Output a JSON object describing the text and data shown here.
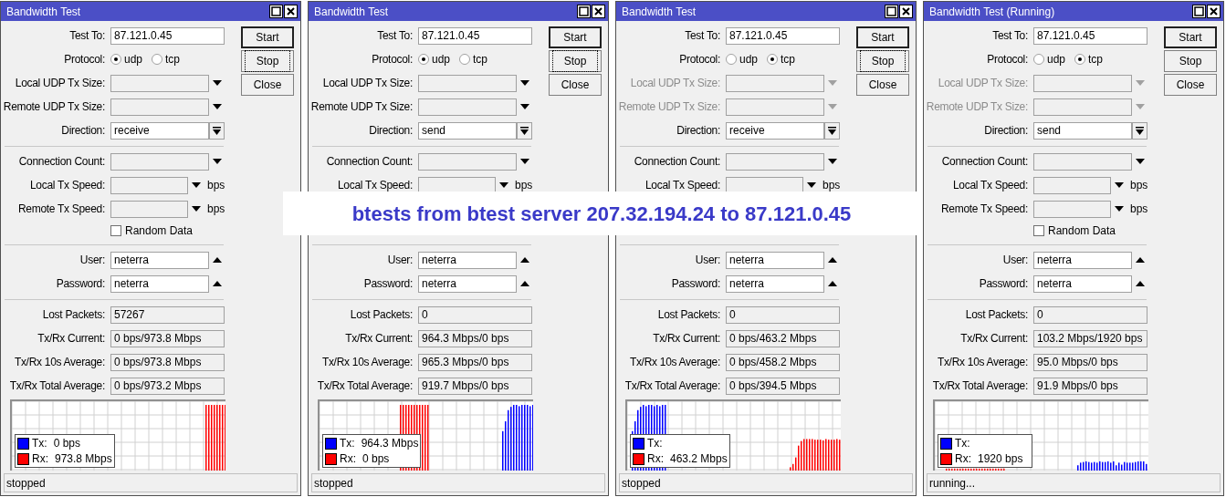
{
  "windows": [
    {
      "title": "Bandwidth Test",
      "buttons": [
        {
          "label": "Start",
          "default": true,
          "focused": false
        },
        {
          "label": "Stop",
          "default": false,
          "focused": true
        },
        {
          "label": "Close",
          "default": false,
          "focused": false
        }
      ],
      "sections": [
        [
          {
            "kind": "text",
            "label": "Test To:",
            "value": "87.121.0.45"
          },
          {
            "kind": "radio",
            "label": "Protocol:",
            "options": [
              {
                "label": "udp",
                "selected": true
              },
              {
                "label": "tcp",
                "selected": false
              }
            ]
          },
          {
            "kind": "combo",
            "label": "Local UDP Tx Size:",
            "disabled": false
          },
          {
            "kind": "combo",
            "label": "Remote UDP Tx Size:",
            "disabled": false
          },
          {
            "kind": "select",
            "label": "Direction:",
            "value": "receive"
          }
        ],
        [
          {
            "kind": "combo",
            "label": "Connection Count:",
            "disabled": false
          },
          {
            "kind": "combo",
            "label": "Local Tx Speed:",
            "disabled": false,
            "unit": "bps"
          },
          {
            "kind": "combo",
            "label": "Remote Tx Speed:",
            "disabled": false,
            "unit": "bps"
          },
          {
            "kind": "checkbox",
            "label": "Random Data",
            "checked": false
          }
        ],
        [
          {
            "kind": "history",
            "label": "User:",
            "value": "neterra"
          },
          {
            "kind": "history",
            "label": "Password:",
            "value": "neterra"
          }
        ],
        [
          {
            "kind": "readonly",
            "label": "Lost Packets:",
            "value": "57267"
          },
          {
            "kind": "readonly",
            "label": "Tx/Rx Current:",
            "value": "0 bps/973.8 Mbps"
          },
          {
            "kind": "readonly",
            "label": "Tx/Rx 10s Average:",
            "value": "0 bps/973.8 Mbps"
          },
          {
            "kind": "readonly",
            "label": "Tx/Rx Total Average:",
            "value": "0 bps/973.2 Mbps"
          }
        ]
      ],
      "legend": [
        {
          "label": "Tx:",
          "value": "0 bps",
          "color": "#0000ff"
        },
        {
          "label": "Rx:",
          "value": "973.8 Mbps",
          "color": "#ff0000"
        }
      ],
      "status": "stopped"
    },
    {
      "title": "Bandwidth Test",
      "buttons": [
        {
          "label": "Start",
          "default": true,
          "focused": false
        },
        {
          "label": "Stop",
          "default": false,
          "focused": true
        },
        {
          "label": "Close",
          "default": false,
          "focused": false
        }
      ],
      "sections": [
        [
          {
            "kind": "text",
            "label": "Test To:",
            "value": "87.121.0.45"
          },
          {
            "kind": "radio",
            "label": "Protocol:",
            "options": [
              {
                "label": "udp",
                "selected": true
              },
              {
                "label": "tcp",
                "selected": false
              }
            ]
          },
          {
            "kind": "combo",
            "label": "Local UDP Tx Size:",
            "disabled": false
          },
          {
            "kind": "combo",
            "label": "Remote UDP Tx Size:",
            "disabled": false
          },
          {
            "kind": "select",
            "label": "Direction:",
            "value": "send"
          }
        ],
        [
          {
            "kind": "combo",
            "label": "Connection Count:",
            "disabled": false
          },
          {
            "kind": "combo",
            "label": "Local Tx Speed:",
            "disabled": false,
            "unit": "bps"
          }
        ],
        [
          {
            "kind": "history",
            "label": "User:",
            "value": "neterra"
          },
          {
            "kind": "history",
            "label": "Password:",
            "value": "neterra"
          }
        ],
        [
          {
            "kind": "readonly",
            "label": "Lost Packets:",
            "value": "0"
          },
          {
            "kind": "readonly",
            "label": "Tx/Rx Current:",
            "value": "964.3 Mbps/0 bps"
          },
          {
            "kind": "readonly",
            "label": "Tx/Rx 10s Average:",
            "value": "965.3 Mbps/0 bps"
          },
          {
            "kind": "readonly",
            "label": "Tx/Rx Total Average:",
            "value": "919.7 Mbps/0 bps"
          }
        ]
      ],
      "legend": [
        {
          "label": "Tx:",
          "value": "964.3 Mbps",
          "color": "#0000ff"
        },
        {
          "label": "Rx:",
          "value": "0 bps",
          "color": "#ff0000"
        }
      ],
      "status": "stopped"
    },
    {
      "title": "Bandwidth Test",
      "buttons": [
        {
          "label": "Start",
          "default": true,
          "focused": false
        },
        {
          "label": "Stop",
          "default": false,
          "focused": true
        },
        {
          "label": "Close",
          "default": false,
          "focused": false
        }
      ],
      "sections": [
        [
          {
            "kind": "text",
            "label": "Test To:",
            "value": "87.121.0.45"
          },
          {
            "kind": "radio",
            "label": "Protocol:",
            "options": [
              {
                "label": "udp",
                "selected": false
              },
              {
                "label": "tcp",
                "selected": true
              }
            ]
          },
          {
            "kind": "combo",
            "label": "Local UDP Tx Size:",
            "disabled": true
          },
          {
            "kind": "combo",
            "label": "Remote UDP Tx Size:",
            "disabled": true
          },
          {
            "kind": "select",
            "label": "Direction:",
            "value": "receive"
          }
        ],
        [
          {
            "kind": "combo",
            "label": "Connection Count:",
            "disabled": false
          },
          {
            "kind": "combo",
            "label": "Local Tx Speed:",
            "disabled": false,
            "unit": "bps"
          }
        ],
        [
          {
            "kind": "history",
            "label": "User:",
            "value": "neterra"
          },
          {
            "kind": "history",
            "label": "Password:",
            "value": "neterra"
          }
        ],
        [
          {
            "kind": "readonly",
            "label": "Lost Packets:",
            "value": "0"
          },
          {
            "kind": "readonly",
            "label": "Tx/Rx Current:",
            "value": "0 bps/463.2 Mbps"
          },
          {
            "kind": "readonly",
            "label": "Tx/Rx 10s Average:",
            "value": "0 bps/458.2 Mbps"
          },
          {
            "kind": "readonly",
            "label": "Tx/Rx Total Average:",
            "value": "0 bps/394.5 Mbps"
          }
        ]
      ],
      "legend": [
        {
          "label": "Tx:",
          "color": "#0000ff"
        },
        {
          "label": "Rx:",
          "value": "463.2 Mbps",
          "color": "#ff0000"
        }
      ],
      "status": "stopped"
    },
    {
      "title": "Bandwidth Test (Running)",
      "buttons": [
        {
          "label": "Start",
          "default": true,
          "focused": false
        },
        {
          "label": "Stop",
          "default": false,
          "focused": false
        },
        {
          "label": "Close",
          "default": false,
          "focused": false
        }
      ],
      "sections": [
        [
          {
            "kind": "text",
            "label": "Test To:",
            "value": "87.121.0.45"
          },
          {
            "kind": "radio",
            "label": "Protocol:",
            "options": [
              {
                "label": "udp",
                "selected": false
              },
              {
                "label": "tcp",
                "selected": true
              }
            ]
          },
          {
            "kind": "combo",
            "label": "Local UDP Tx Size:",
            "disabled": true
          },
          {
            "kind": "combo",
            "label": "Remote UDP Tx Size:",
            "disabled": true
          },
          {
            "kind": "select",
            "label": "Direction:",
            "value": "send"
          }
        ],
        [
          {
            "kind": "combo",
            "label": "Connection Count:",
            "disabled": false
          },
          {
            "kind": "combo",
            "label": "Local Tx Speed:",
            "disabled": false,
            "unit": "bps"
          },
          {
            "kind": "combo",
            "label": "Remote Tx Speed:",
            "disabled": false,
            "unit": "bps"
          },
          {
            "kind": "checkbox",
            "label": "Random Data",
            "checked": false
          }
        ],
        [
          {
            "kind": "history",
            "label": "User:",
            "value": "neterra"
          },
          {
            "kind": "history",
            "label": "Password:",
            "value": "neterra"
          }
        ],
        [
          {
            "kind": "readonly",
            "label": "Lost Packets:",
            "value": "0"
          },
          {
            "kind": "readonly",
            "label": "Tx/Rx Current:",
            "value": "103.2 Mbps/1920 bps"
          },
          {
            "kind": "readonly",
            "label": "Tx/Rx 10s Average:",
            "value": "95.0 Mbps/0 bps"
          },
          {
            "kind": "readonly",
            "label": "Tx/Rx Total Average:",
            "value": "91.9 Mbps/0 bps"
          }
        ]
      ],
      "legend": [
        {
          "label": "Tx:",
          "color": "#0000ff"
        },
        {
          "label": "Rx:",
          "value": "1920 bps",
          "color": "#ff0000"
        }
      ],
      "status": "running..."
    }
  ],
  "banner": {
    "text": "btests from btest server 207.32.194.24 to 87.121.0.45"
  }
}
